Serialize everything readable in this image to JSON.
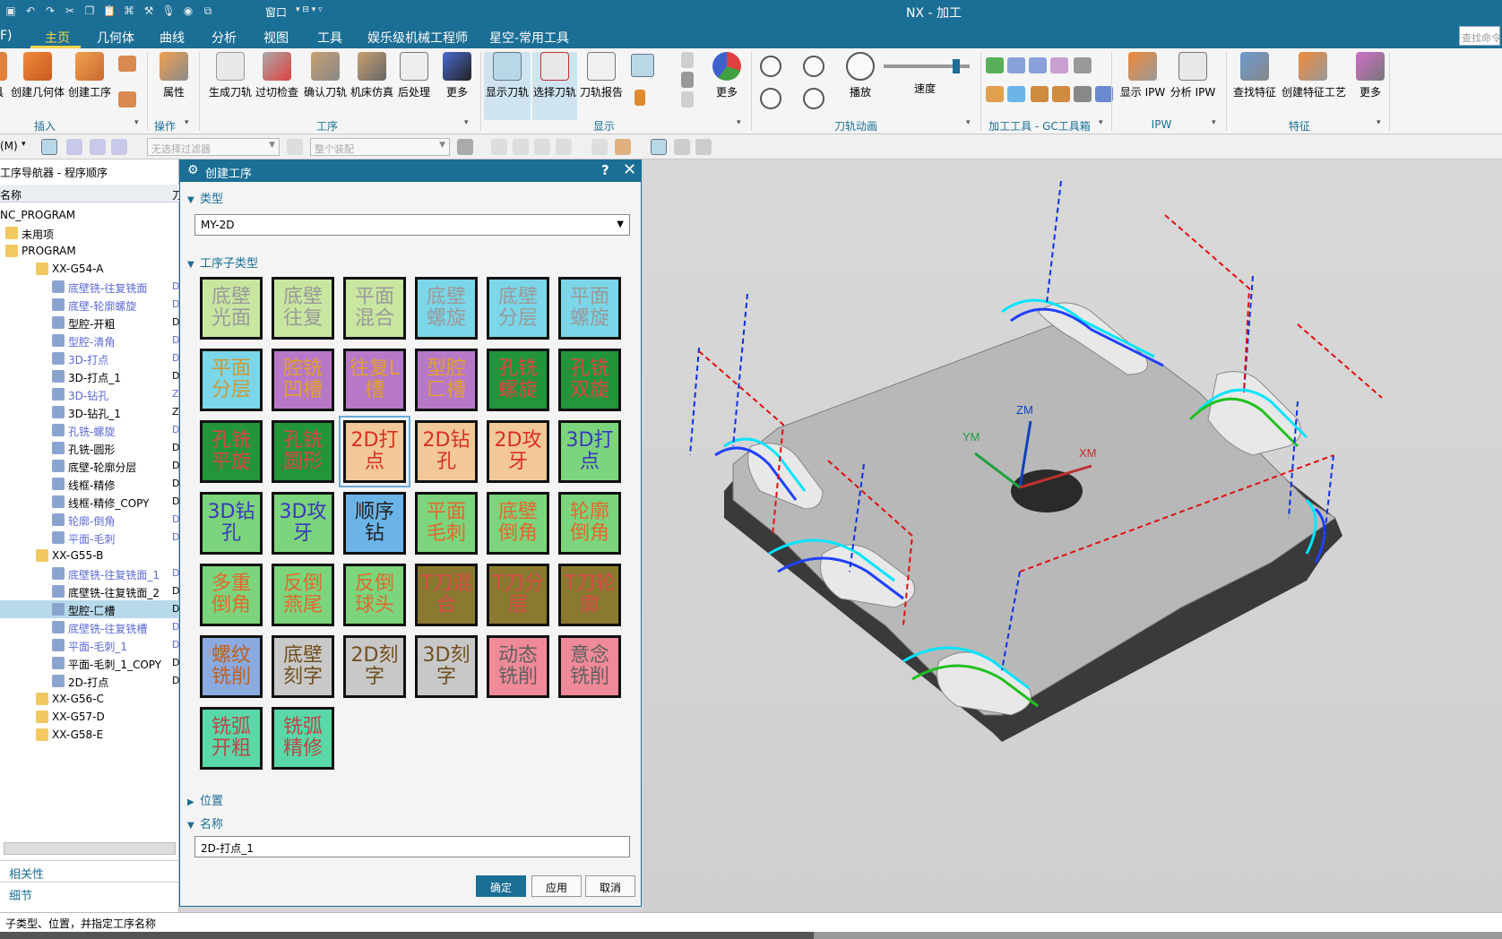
{
  "app": {
    "title": "NX - 加工",
    "quick_access": [
      "save-icon",
      "undo-icon",
      "redo-icon",
      "cut-icon",
      "copy-icon",
      "paste-icon",
      "format-painter-icon",
      "mic-icon",
      "window-icon"
    ],
    "window_menu": "窗口",
    "menu_partial": "F)",
    "tabs": [
      "主页",
      "几何体",
      "曲线",
      "分析",
      "视图",
      "工具",
      "娱乐级机械工程师",
      "星空-常用工具"
    ],
    "active_tab": "主页",
    "search_placeholder": "查找命令"
  },
  "ribbon": {
    "buttons": [
      {
        "label": "具",
        "id": "tool"
      },
      {
        "label": "创建几何体",
        "id": "create-geometry"
      },
      {
        "label": "创建工序",
        "id": "create-operation"
      },
      {
        "label": "属性",
        "id": "properties"
      },
      {
        "label": "生成刀轨",
        "id": "generate-toolpath"
      },
      {
        "label": "过切检查",
        "id": "gouge-check"
      },
      {
        "label": "确认刀轨",
        "id": "verify-toolpath"
      },
      {
        "label": "机床仿真",
        "id": "machine-sim"
      },
      {
        "label": "后处理",
        "id": "postprocess"
      },
      {
        "label": "更多",
        "id": "more-1"
      },
      {
        "label": "显示刀轨",
        "id": "show-toolpath"
      },
      {
        "label": "选择刀轨",
        "id": "select-toolpath"
      },
      {
        "label": "刀轨报告",
        "id": "toolpath-report"
      },
      {
        "label": "更多",
        "id": "more-2"
      },
      {
        "label": "播放",
        "id": "play"
      },
      {
        "label": "速度",
        "id": "speed"
      },
      {
        "label": "显示 IPW",
        "id": "show-ipw"
      },
      {
        "label": "分析 IPW",
        "id": "analyze-ipw"
      },
      {
        "label": "查找特征",
        "id": "find-feature"
      },
      {
        "label": "创建特征工艺",
        "id": "create-feature-process"
      },
      {
        "label": "更多",
        "id": "more-3"
      }
    ],
    "groups": [
      "插入",
      "操作",
      "工序",
      "显示",
      "刀轨动画",
      "加工工具 - GC工具箱",
      "IPW",
      "特征"
    ],
    "speed_slider_value": 0.87
  },
  "toolbar2": {
    "mode": "(M)",
    "filter_placeholder": "无选择过滤器",
    "assembly_placeholder": "整个装配"
  },
  "navigator": {
    "title": "工序导航器 - 程序顺序",
    "column_name": "名称",
    "column_2": "刀",
    "rows": [
      {
        "name": "NC_PROGRAM",
        "depth": 0,
        "kind": "root",
        "blue": false,
        "col": ""
      },
      {
        "name": "未用项",
        "depth": 1,
        "kind": "folder",
        "blue": false,
        "col": ""
      },
      {
        "name": "PROGRAM",
        "depth": 1,
        "kind": "folder",
        "blue": false,
        "col": ""
      },
      {
        "name": "XX-G54-A",
        "depth": 2,
        "kind": "folder",
        "blue": false,
        "col": ""
      },
      {
        "name": "底壁铣-往复铣面",
        "depth": 3,
        "kind": "op",
        "blue": true,
        "col": "D"
      },
      {
        "name": "底壁-轮廓螺旋",
        "depth": 3,
        "kind": "op",
        "blue": true,
        "col": "D"
      },
      {
        "name": "型腔-开粗",
        "depth": 3,
        "kind": "op",
        "blue": false,
        "col": "D"
      },
      {
        "name": "型腔-清角",
        "depth": 3,
        "kind": "op",
        "blue": true,
        "col": "D"
      },
      {
        "name": "3D-打点",
        "depth": 3,
        "kind": "op",
        "blue": true,
        "col": "D"
      },
      {
        "name": "3D-打点_1",
        "depth": 3,
        "kind": "op",
        "blue": false,
        "col": "D"
      },
      {
        "name": "3D-钻孔",
        "depth": 3,
        "kind": "op",
        "blue": true,
        "col": "Z"
      },
      {
        "name": "3D-钻孔_1",
        "depth": 3,
        "kind": "op",
        "blue": false,
        "col": "Z"
      },
      {
        "name": "孔铣-螺旋",
        "depth": 3,
        "kind": "op",
        "blue": true,
        "col": "D"
      },
      {
        "name": "孔铣-圆形",
        "depth": 3,
        "kind": "op",
        "blue": false,
        "col": "D"
      },
      {
        "name": "底壁-轮廓分层",
        "depth": 3,
        "kind": "op",
        "blue": false,
        "col": "D"
      },
      {
        "name": "线框-精修",
        "depth": 3,
        "kind": "op",
        "blue": false,
        "col": "D"
      },
      {
        "name": "线框-精修_COPY",
        "depth": 3,
        "kind": "op",
        "blue": false,
        "col": "D"
      },
      {
        "name": "轮廓-倒角",
        "depth": 3,
        "kind": "op",
        "blue": true,
        "col": "D"
      },
      {
        "name": "平面-毛刺",
        "depth": 3,
        "kind": "op",
        "blue": true,
        "col": "D"
      },
      {
        "name": "XX-G55-B",
        "depth": 2,
        "kind": "folder",
        "blue": false,
        "col": ""
      },
      {
        "name": "底壁铣-往复铣面_1",
        "depth": 3,
        "kind": "op",
        "blue": true,
        "col": "D"
      },
      {
        "name": "底壁铣-往复铣面_2",
        "depth": 3,
        "kind": "op",
        "blue": false,
        "col": "D"
      },
      {
        "name": "型腔-匚槽",
        "depth": 3,
        "kind": "op",
        "blue": false,
        "col": "D",
        "selected": true
      },
      {
        "name": "底壁铣-往复铣槽",
        "depth": 3,
        "kind": "op",
        "blue": true,
        "col": "D"
      },
      {
        "name": "平面-毛刺_1",
        "depth": 3,
        "kind": "op",
        "blue": true,
        "col": "D"
      },
      {
        "name": "平面-毛刺_1_COPY",
        "depth": 3,
        "kind": "op",
        "blue": false,
        "col": "D"
      },
      {
        "name": "2D-打点",
        "depth": 3,
        "kind": "op",
        "blue": false,
        "col": "D"
      },
      {
        "name": "XX-G56-C",
        "depth": 2,
        "kind": "check",
        "blue": false,
        "col": ""
      },
      {
        "name": "XX-G57-D",
        "depth": 2,
        "kind": "check",
        "blue": false,
        "col": ""
      },
      {
        "name": "XX-G58-E",
        "depth": 2,
        "kind": "check",
        "blue": false,
        "col": ""
      }
    ],
    "panel_related": "相关性",
    "panel_details": "细节"
  },
  "dialog": {
    "title": "创建工序",
    "help": "?",
    "close": "✕",
    "section_type": "类型",
    "type_value": "MY-2D",
    "section_subtype": "工序子类型",
    "tiles": [
      {
        "text": "底壁光面",
        "bg": "#c8e6a0",
        "fg": "#9a9a9a"
      },
      {
        "text": "底壁往复",
        "bg": "#c8e6a0",
        "fg": "#9a9a9a"
      },
      {
        "text": "平面混合",
        "bg": "#c8e6a0",
        "fg": "#9a9a9a"
      },
      {
        "text": "底壁螺旋",
        "bg": "#7ad6e8",
        "fg": "#9a9a9a"
      },
      {
        "text": "底壁分层",
        "bg": "#7ad6e8",
        "fg": "#9a9a9a"
      },
      {
        "text": "平面螺旋",
        "bg": "#7ad6e8",
        "fg": "#9a9a9a"
      },
      {
        "text": "平面分层",
        "bg": "#7ad6e8",
        "fg": "#c89a3a"
      },
      {
        "text": "腔铣凹槽",
        "bg": "#b878c8",
        "fg": "#e0a030"
      },
      {
        "text": "往复L槽",
        "bg": "#b878c8",
        "fg": "#e0a030"
      },
      {
        "text": "型腔匚槽",
        "bg": "#b878c8",
        "fg": "#e0a030"
      },
      {
        "text": "孔铣螺旋",
        "bg": "#22943a",
        "fg": "#d84848"
      },
      {
        "text": "孔铣双旋",
        "bg": "#22943a",
        "fg": "#d84848"
      },
      {
        "text": "孔铣平旋",
        "bg": "#22943a",
        "fg": "#d84848"
      },
      {
        "text": "孔铣圆形",
        "bg": "#22943a",
        "fg": "#d84848"
      },
      {
        "text": "2D打点",
        "bg": "#f2c898",
        "fg": "#d83020",
        "selected": true
      },
      {
        "text": "2D钻孔",
        "bg": "#f2c898",
        "fg": "#d83020"
      },
      {
        "text": "2D攻牙",
        "bg": "#f2c898",
        "fg": "#d83020"
      },
      {
        "text": "3D打点",
        "bg": "#7cd47c",
        "fg": "#3a3ab8"
      },
      {
        "text": "3D钻孔",
        "bg": "#7cd47c",
        "fg": "#3a3ab8"
      },
      {
        "text": "3D攻牙",
        "bg": "#7cd47c",
        "fg": "#3a3ab8"
      },
      {
        "text": "顺序钻",
        "bg": "#6ab4e8",
        "fg": "#222222"
      },
      {
        "text": "平面毛刺",
        "bg": "#7cd47c",
        "fg": "#e06a30"
      },
      {
        "text": "底壁倒角",
        "bg": "#7cd47c",
        "fg": "#e06a30"
      },
      {
        "text": "轮廓倒角",
        "bg": "#7cd47c",
        "fg": "#e06a30"
      },
      {
        "text": "多重倒角",
        "bg": "#7cd47c",
        "fg": "#e06a30"
      },
      {
        "text": "反倒燕尾",
        "bg": "#7cd47c",
        "fg": "#e06a30"
      },
      {
        "text": "反倒球头",
        "bg": "#7cd47c",
        "fg": "#e06a30"
      },
      {
        "text": "T刀混合",
        "bg": "#8a7a30",
        "fg": "#d84848"
      },
      {
        "text": "T刀分层",
        "bg": "#8a7a30",
        "fg": "#d84848"
      },
      {
        "text": "T刀轮廓",
        "bg": "#8a7a30",
        "fg": "#d84848"
      },
      {
        "text": "螺纹铣削",
        "bg": "#8aaae0",
        "fg": "#c06020"
      },
      {
        "text": "底壁刻字",
        "bg": "#c8c8c8",
        "fg": "#705020"
      },
      {
        "text": "2D刻字",
        "bg": "#c8c8c8",
        "fg": "#705020"
      },
      {
        "text": "3D刻字",
        "bg": "#c8c8c8",
        "fg": "#705020"
      },
      {
        "text": "动态铣削",
        "bg": "#f08a98",
        "fg": "#606060"
      },
      {
        "text": "意念铣削",
        "bg": "#f08a98",
        "fg": "#606060"
      },
      {
        "text": "铣弧开粗",
        "bg": "#5ad8a8",
        "fg": "#b84848"
      },
      {
        "text": "铣弧精修",
        "bg": "#5ad8a8",
        "fg": "#b84848"
      }
    ],
    "section_position": "位置",
    "section_name": "名称",
    "name_value": "2D-打点_1",
    "ok": "确定",
    "apply": "应用",
    "cancel": "取消"
  },
  "viewport": {
    "axis_x": "XM",
    "axis_y": "YM",
    "axis_z": "ZM"
  },
  "status": {
    "text": "子类型、位置，并指定工序名称"
  }
}
